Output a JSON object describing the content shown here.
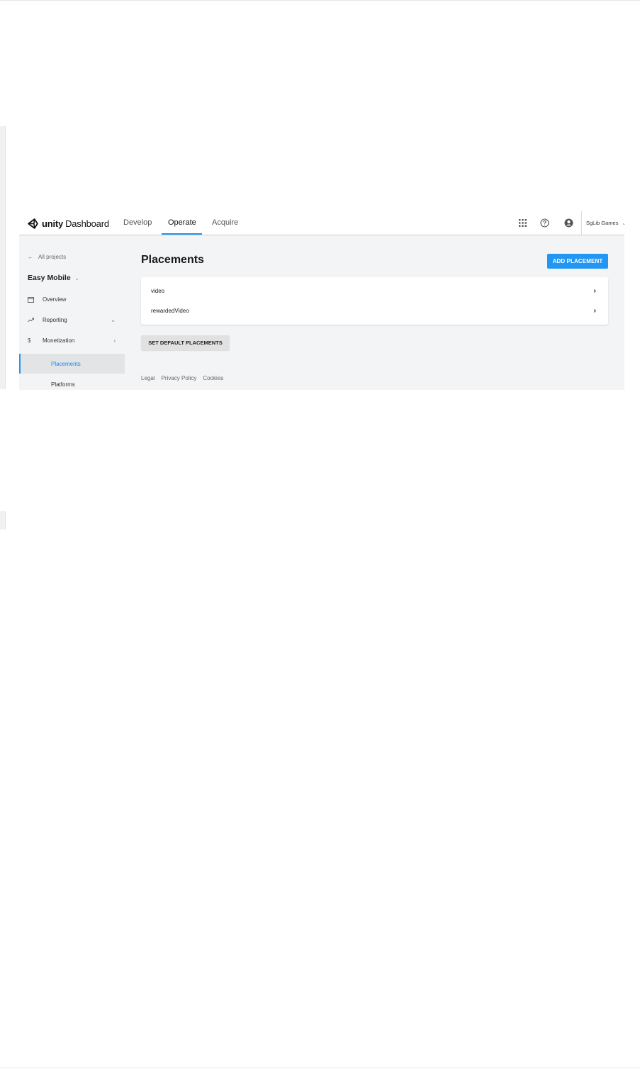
{
  "topbar": {
    "brand_bold": "unity",
    "brand_rest": "Dashboard",
    "tabs": [
      {
        "label": "Develop",
        "active": false
      },
      {
        "label": "Operate",
        "active": true
      },
      {
        "label": "Acquire",
        "active": false
      }
    ],
    "icons": [
      "apps-grid-icon",
      "help-circle-icon",
      "account-circle-icon"
    ],
    "org_name": "SgLib Games",
    "org_caret": "⌄"
  },
  "sidebar": {
    "back_label": "All projects",
    "project_name": "Easy Mobile",
    "items": [
      {
        "label": "Overview",
        "icon": "calendar-icon"
      },
      {
        "label": "Reporting",
        "icon": "trending-up-icon",
        "chevron": "⌄"
      },
      {
        "label": "Monetization",
        "icon": "dollar-icon",
        "chevron": "›"
      }
    ],
    "sub_items": [
      {
        "label": "Placements",
        "active": true
      },
      {
        "label": "Platforms",
        "active": false
      }
    ]
  },
  "main": {
    "title": "Placements",
    "add_button_label": "ADD PLACEMENT",
    "placements": [
      "video",
      "rewardedVideo"
    ],
    "set_default_label": "SET DEFAULT PLACEMENTS",
    "footer_links": [
      "Legal",
      "Privacy Policy",
      "Cookies"
    ]
  },
  "colors": {
    "accent": "#2196f3",
    "page_bg": "#f3f4f5"
  }
}
